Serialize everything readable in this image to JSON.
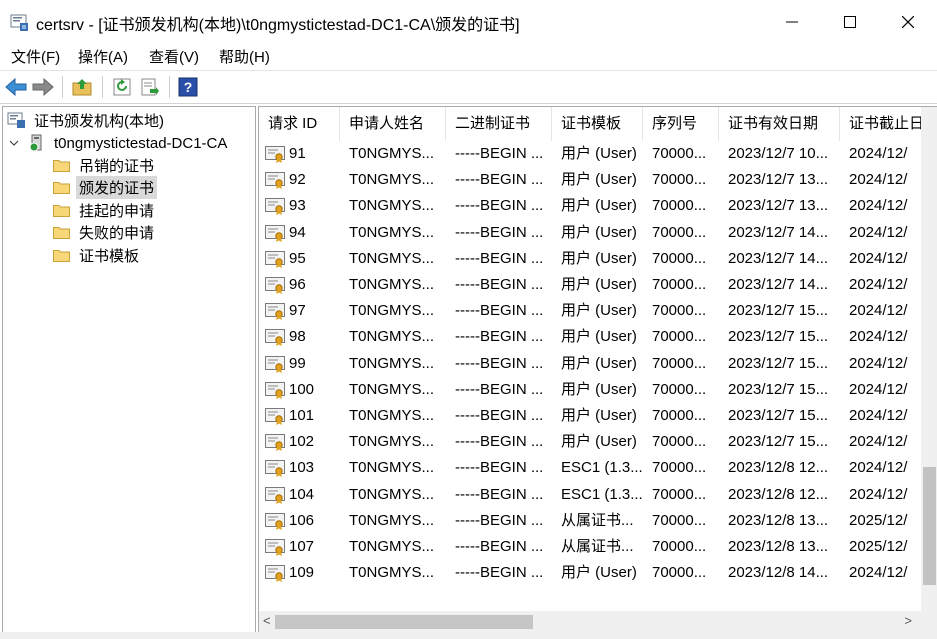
{
  "window": {
    "title": "certsrv - [证书颁发机构(本地)\\t0ngmystictestad-DC1-CA\\颁发的证书]",
    "minimize": "—",
    "maximize": "☐",
    "close": "✕"
  },
  "menu": [
    "文件(F)",
    "操作(A)",
    "查看(V)",
    "帮助(H)"
  ],
  "toolbar": {
    "buttons": [
      "back-arrow-icon",
      "forward-arrow-icon",
      "up-folder-icon",
      "refresh-icon",
      "export-list-icon",
      "help-icon"
    ]
  },
  "tree": {
    "root": "证书颁发机构(本地)",
    "ca": "t0ngmystictestad-DC1-CA",
    "folders": [
      "吊销的证书",
      "颁发的证书",
      "挂起的申请",
      "失败的申请",
      "证书模板"
    ],
    "selected_index": 1
  },
  "columns": [
    "请求 ID",
    "申请人姓名",
    "二进制证书",
    "证书模板",
    "序列号",
    "证书有效日期",
    "证书截止日期"
  ],
  "rows": [
    {
      "id": "91",
      "name": "T0NGMYS...",
      "bin": "-----BEGIN ...",
      "template": "用户 (User)",
      "serial": "70000...",
      "from": "2023/12/7 10...",
      "to": "2024/12/"
    },
    {
      "id": "92",
      "name": "T0NGMYS...",
      "bin": "-----BEGIN ...",
      "template": "用户 (User)",
      "serial": "70000...",
      "from": "2023/12/7 13...",
      "to": "2024/12/"
    },
    {
      "id": "93",
      "name": "T0NGMYS...",
      "bin": "-----BEGIN ...",
      "template": "用户 (User)",
      "serial": "70000...",
      "from": "2023/12/7 13...",
      "to": "2024/12/"
    },
    {
      "id": "94",
      "name": "T0NGMYS...",
      "bin": "-----BEGIN ...",
      "template": "用户 (User)",
      "serial": "70000...",
      "from": "2023/12/7 14...",
      "to": "2024/12/"
    },
    {
      "id": "95",
      "name": "T0NGMYS...",
      "bin": "-----BEGIN ...",
      "template": "用户 (User)",
      "serial": "70000...",
      "from": "2023/12/7 14...",
      "to": "2024/12/"
    },
    {
      "id": "96",
      "name": "T0NGMYS...",
      "bin": "-----BEGIN ...",
      "template": "用户 (User)",
      "serial": "70000...",
      "from": "2023/12/7 14...",
      "to": "2024/12/"
    },
    {
      "id": "97",
      "name": "T0NGMYS...",
      "bin": "-----BEGIN ...",
      "template": "用户 (User)",
      "serial": "70000...",
      "from": "2023/12/7 15...",
      "to": "2024/12/"
    },
    {
      "id": "98",
      "name": "T0NGMYS...",
      "bin": "-----BEGIN ...",
      "template": "用户 (User)",
      "serial": "70000...",
      "from": "2023/12/7 15...",
      "to": "2024/12/"
    },
    {
      "id": "99",
      "name": "T0NGMYS...",
      "bin": "-----BEGIN ...",
      "template": "用户 (User)",
      "serial": "70000...",
      "from": "2023/12/7 15...",
      "to": "2024/12/"
    },
    {
      "id": "100",
      "name": "T0NGMYS...",
      "bin": "-----BEGIN ...",
      "template": "用户 (User)",
      "serial": "70000...",
      "from": "2023/12/7 15...",
      "to": "2024/12/"
    },
    {
      "id": "101",
      "name": "T0NGMYS...",
      "bin": "-----BEGIN ...",
      "template": "用户 (User)",
      "serial": "70000...",
      "from": "2023/12/7 15...",
      "to": "2024/12/"
    },
    {
      "id": "102",
      "name": "T0NGMYS...",
      "bin": "-----BEGIN ...",
      "template": "用户 (User)",
      "serial": "70000...",
      "from": "2023/12/7 15...",
      "to": "2024/12/"
    },
    {
      "id": "103",
      "name": "T0NGMYS...",
      "bin": "-----BEGIN ...",
      "template": "ESC1 (1.3....",
      "serial": "70000...",
      "from": "2023/12/8 12...",
      "to": "2024/12/"
    },
    {
      "id": "104",
      "name": "T0NGMYS...",
      "bin": "-----BEGIN ...",
      "template": "ESC1 (1.3....",
      "serial": "70000...",
      "from": "2023/12/8 12...",
      "to": "2024/12/"
    },
    {
      "id": "106",
      "name": "T0NGMYS...",
      "bin": "-----BEGIN ...",
      "template": "从属证书...",
      "serial": "70000...",
      "from": "2023/12/8 13...",
      "to": "2025/12/"
    },
    {
      "id": "107",
      "name": "T0NGMYS...",
      "bin": "-----BEGIN ...",
      "template": "从属证书...",
      "serial": "70000...",
      "from": "2023/12/8 13...",
      "to": "2025/12/"
    },
    {
      "id": "109",
      "name": "T0NGMYS...",
      "bin": "-----BEGIN ...",
      "template": "用户 (User)",
      "serial": "70000...",
      "from": "2023/12/8 14...",
      "to": "2024/12/"
    }
  ],
  "scroll": {
    "left_arrow": "<",
    "right_arrow": ">"
  }
}
